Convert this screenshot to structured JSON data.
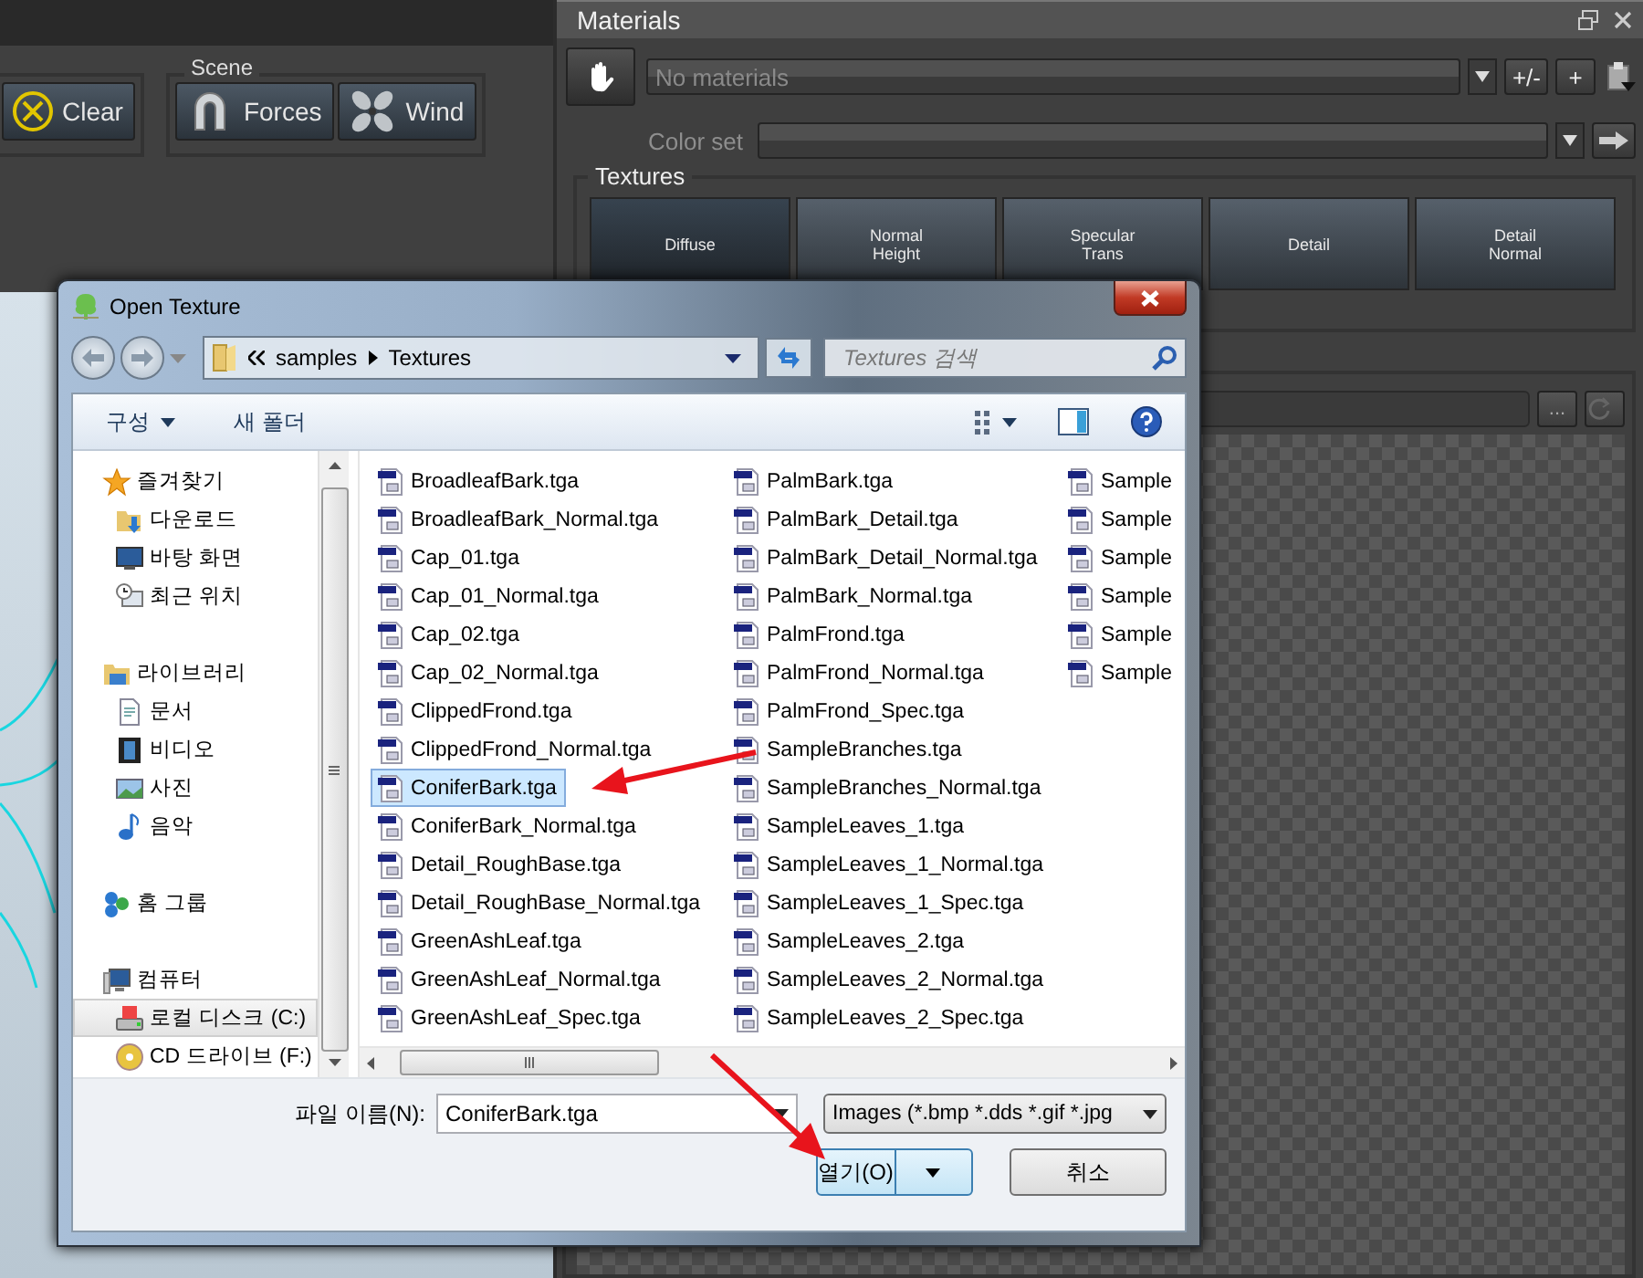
{
  "app_toolbar": {
    "clear_button": {
      "label": "Clear"
    },
    "scene_group": {
      "title": "Scene",
      "buttons": [
        {
          "label": "Forces"
        },
        {
          "label": "Wind"
        }
      ]
    }
  },
  "materials_panel": {
    "title": "Materials",
    "material_select": {
      "placeholder": "No materials"
    },
    "buttons": [
      "+/-",
      "+"
    ],
    "color_set": {
      "label": "Color set"
    },
    "textures": {
      "title": "Textures",
      "slots": [
        {
          "label": "Diffuse",
          "selected": true
        },
        {
          "label": "Normal\nHeight",
          "selected": false
        },
        {
          "label": "Specular\nTrans",
          "selected": false
        },
        {
          "label": "Detail",
          "selected": false
        },
        {
          "label": "Detail\nNormal",
          "selected": false
        }
      ]
    },
    "layer_browse_button": "..."
  },
  "dialog": {
    "title": "Open Texture",
    "breadcrumb": [
      "samples",
      "Textures"
    ],
    "search": {
      "placeholder": "Textures 검색"
    },
    "toolbar": {
      "organize": "구성",
      "new_folder": "새 폴더"
    },
    "navigation_pane": [
      {
        "label": "즐겨찾기",
        "selected": false,
        "children": [
          {
            "label": "다운로드",
            "selected": false
          },
          {
            "label": "바탕 화면",
            "selected": false
          },
          {
            "label": "최근 위치",
            "selected": false
          }
        ]
      },
      {
        "label": "라이브러리",
        "selected": false,
        "children": [
          {
            "label": "문서",
            "selected": false
          },
          {
            "label": "비디오",
            "selected": false
          },
          {
            "label": "사진",
            "selected": false
          },
          {
            "label": "음악",
            "selected": false
          }
        ]
      },
      {
        "label": "홈 그룹",
        "selected": false
      },
      {
        "label": "컴퓨터",
        "selected": false,
        "children": [
          {
            "label": "로컬 디스크 (C:)",
            "selected": true
          },
          {
            "label": "CD 드라이브 (F:)",
            "selected": false
          }
        ]
      }
    ],
    "file_columns": [
      [
        {
          "name": "BroadleafBark.tga",
          "selected": false
        },
        {
          "name": "BroadleafBark_Normal.tga",
          "selected": false
        },
        {
          "name": "Cap_01.tga",
          "selected": false
        },
        {
          "name": "Cap_01_Normal.tga",
          "selected": false
        },
        {
          "name": "Cap_02.tga",
          "selected": false
        },
        {
          "name": "Cap_02_Normal.tga",
          "selected": false
        },
        {
          "name": "ClippedFrond.tga",
          "selected": false
        },
        {
          "name": "ClippedFrond_Normal.tga",
          "selected": false
        },
        {
          "name": "ConiferBark.tga",
          "selected": true
        },
        {
          "name": "ConiferBark_Normal.tga",
          "selected": false
        },
        {
          "name": "Detail_RoughBase.tga",
          "selected": false
        },
        {
          "name": "Detail_RoughBase_Normal.tga",
          "selected": false
        },
        {
          "name": "GreenAshLeaf.tga",
          "selected": false
        },
        {
          "name": "GreenAshLeaf_Normal.tga",
          "selected": false
        },
        {
          "name": "GreenAshLeaf_Spec.tga",
          "selected": false
        }
      ],
      [
        {
          "name": "PalmBark.tga",
          "selected": false
        },
        {
          "name": "PalmBark_Detail.tga",
          "selected": false
        },
        {
          "name": "PalmBark_Detail_Normal.tga",
          "selected": false
        },
        {
          "name": "PalmBark_Normal.tga",
          "selected": false
        },
        {
          "name": "PalmFrond.tga",
          "selected": false
        },
        {
          "name": "PalmFrond_Normal.tga",
          "selected": false
        },
        {
          "name": "PalmFrond_Spec.tga",
          "selected": false
        },
        {
          "name": "SampleBranches.tga",
          "selected": false
        },
        {
          "name": "SampleBranches_Normal.tga",
          "selected": false
        },
        {
          "name": "SampleLeaves_1.tga",
          "selected": false
        },
        {
          "name": "SampleLeaves_1_Normal.tga",
          "selected": false
        },
        {
          "name": "SampleLeaves_1_Spec.tga",
          "selected": false
        },
        {
          "name": "SampleLeaves_2.tga",
          "selected": false
        },
        {
          "name": "SampleLeaves_2_Normal.tga",
          "selected": false
        },
        {
          "name": "SampleLeaves_2_Spec.tga",
          "selected": false
        }
      ],
      [
        {
          "name": "Sample",
          "selected": false
        },
        {
          "name": "Sample",
          "selected": false
        },
        {
          "name": "Sample",
          "selected": false
        },
        {
          "name": "Sample",
          "selected": false
        },
        {
          "name": "Sample",
          "selected": false
        },
        {
          "name": "Sample",
          "selected": false
        }
      ]
    ],
    "file_name": {
      "label": "파일 이름(N):",
      "value": "ConiferBark.tga"
    },
    "file_type": "Images (*.bmp *.dds *.gif *.jpg",
    "open_button": "열기(O)",
    "cancel_button": "취소"
  }
}
